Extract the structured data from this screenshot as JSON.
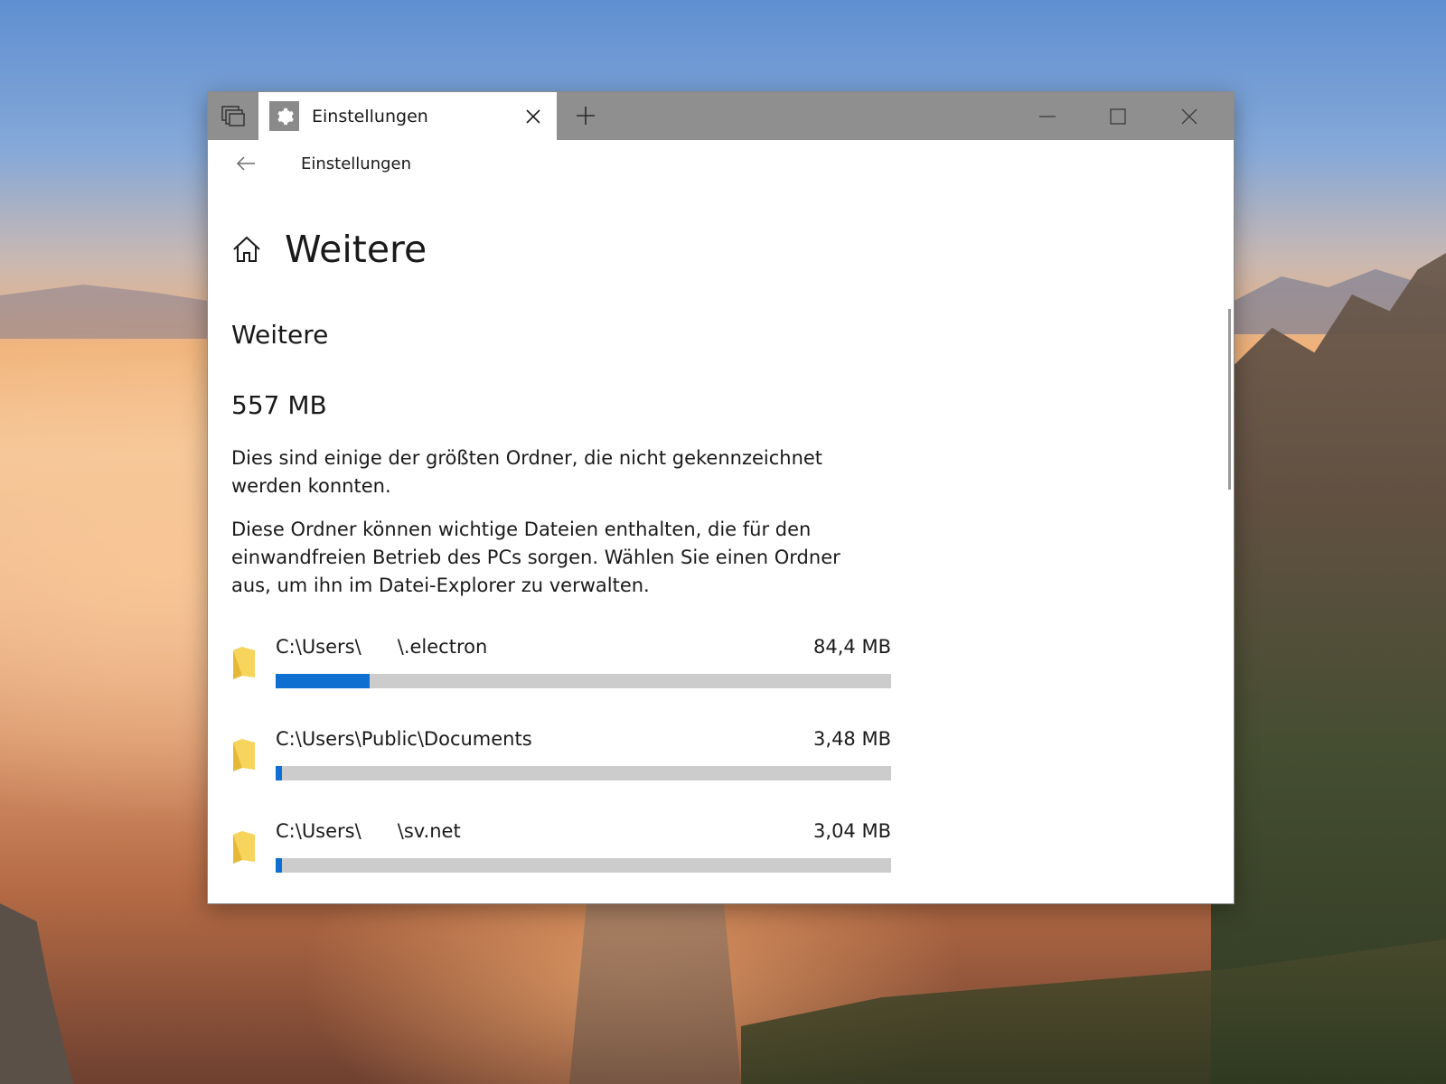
{
  "window": {
    "tab_title": "Einstellungen",
    "nav_title": "Einstellungen"
  },
  "page": {
    "title": "Weitere",
    "section_title": "Weitere",
    "total_size": "557 MB",
    "description_1": "Dies sind einige der größten Ordner, die nicht gekennzeichnet werden konnten.",
    "description_2": "Diese Ordner können wichtige Dateien enthalten, die für den einwandfreien Betrieb des PCs sorgen. Wählen Sie einen Ordner aus, um ihn im Datei-Explorer zu verwalten."
  },
  "folders": [
    {
      "path": "C:\\Users\\      \\.electron",
      "size": "84,4 MB",
      "fraction": 0.152
    },
    {
      "path": "C:\\Users\\Public\\Documents",
      "size": "3,48 MB",
      "fraction": 0.011
    },
    {
      "path": "C:\\Users\\      \\sv.net",
      "size": "3,04 MB",
      "fraction": 0.011
    }
  ],
  "icons": {
    "tabs_overview": "tabs-overview-icon",
    "tab_icon": "gear-icon",
    "tab_close": "close-icon",
    "new_tab": "plus-icon",
    "minimize": "minimize-icon",
    "maximize": "maximize-icon",
    "close": "close-icon",
    "back": "back-arrow-icon",
    "home": "home-icon",
    "folder": "folder-icon"
  },
  "colors": {
    "accent": "#0f6fd1",
    "bar_track": "#cccccc",
    "titlebar": "#8f8f8f"
  }
}
